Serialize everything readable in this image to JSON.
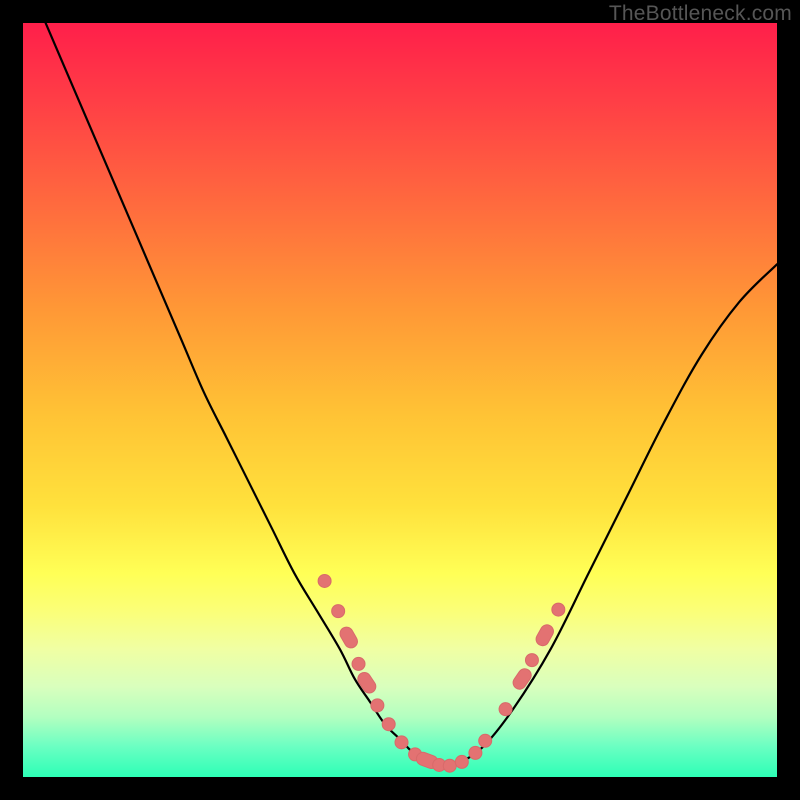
{
  "watermark": "TheBottleneck.com",
  "colors": {
    "frame": "#000000",
    "curve": "#000000",
    "marker_fill": "#e37272",
    "marker_stroke": "#d86a6a"
  },
  "chart_data": {
    "type": "line",
    "title": "",
    "xlabel": "",
    "ylabel": "",
    "xlim": [
      0,
      100
    ],
    "ylim": [
      0,
      100
    ],
    "series": [
      {
        "name": "bottleneck-curve",
        "x": [
          3,
          6,
          9,
          12,
          15,
          18,
          21,
          24,
          27,
          30,
          33,
          36,
          39,
          42,
          44,
          46,
          48,
          50,
          52,
          54,
          56,
          58,
          61,
          65,
          70,
          75,
          80,
          85,
          90,
          95,
          100
        ],
        "y": [
          100,
          93,
          86,
          79,
          72,
          65,
          58,
          51,
          45,
          39,
          33,
          27,
          22,
          17,
          13,
          10,
          7,
          5,
          3,
          2,
          1.5,
          2,
          4,
          9,
          17,
          27,
          37,
          47,
          56,
          63,
          68
        ]
      }
    ],
    "markers": [
      {
        "x": 40.0,
        "y": 26.0,
        "kind": "circle"
      },
      {
        "x": 41.8,
        "y": 22.0,
        "kind": "circle"
      },
      {
        "x": 43.2,
        "y": 18.5,
        "kind": "lozenge"
      },
      {
        "x": 44.5,
        "y": 15.0,
        "kind": "circle"
      },
      {
        "x": 45.6,
        "y": 12.5,
        "kind": "lozenge"
      },
      {
        "x": 47.0,
        "y": 9.5,
        "kind": "circle"
      },
      {
        "x": 48.5,
        "y": 7.0,
        "kind": "circle"
      },
      {
        "x": 50.2,
        "y": 4.6,
        "kind": "circle"
      },
      {
        "x": 52.0,
        "y": 3.0,
        "kind": "circle"
      },
      {
        "x": 53.6,
        "y": 2.2,
        "kind": "lozenge"
      },
      {
        "x": 55.2,
        "y": 1.6,
        "kind": "circle"
      },
      {
        "x": 56.6,
        "y": 1.5,
        "kind": "circle"
      },
      {
        "x": 58.2,
        "y": 2.0,
        "kind": "circle"
      },
      {
        "x": 60.0,
        "y": 3.2,
        "kind": "circle"
      },
      {
        "x": 61.3,
        "y": 4.8,
        "kind": "circle"
      },
      {
        "x": 64.0,
        "y": 9.0,
        "kind": "circle"
      },
      {
        "x": 66.2,
        "y": 13.0,
        "kind": "lozenge"
      },
      {
        "x": 67.5,
        "y": 15.5,
        "kind": "circle"
      },
      {
        "x": 69.2,
        "y": 18.8,
        "kind": "lozenge"
      },
      {
        "x": 71.0,
        "y": 22.2,
        "kind": "circle"
      }
    ]
  }
}
